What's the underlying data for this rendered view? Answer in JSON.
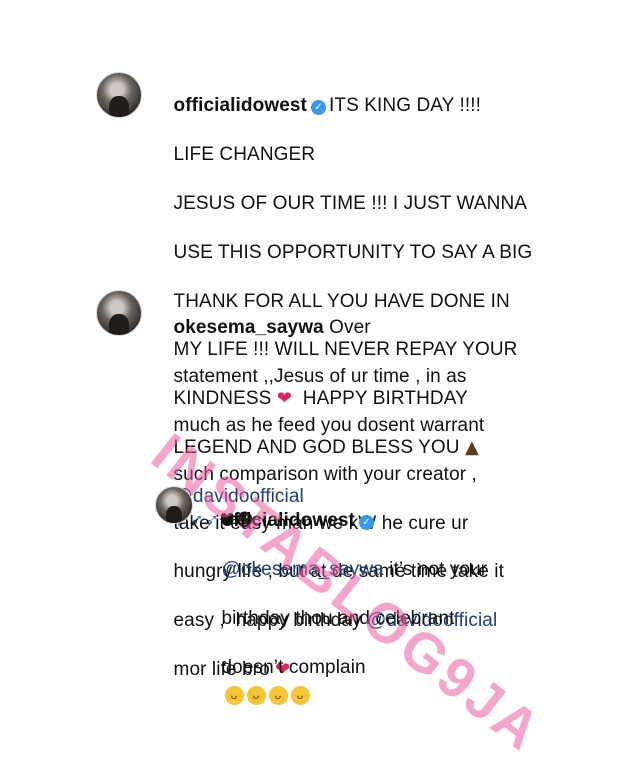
{
  "comments": [
    {
      "username": "officialidowest",
      "verified": true,
      "lines": [
        "ITS KING DAY !!!!",
        "LIFE CHANGER",
        "JESUS OF OUR TIME !!! I JUST WANNA",
        "USE THIS OPPORTUNITY TO SAY A BIG",
        "THANK FOR ALL YOU HAVE DONE IN",
        "MY LIFE !!! WILL NEVER REPAY YOUR",
        "KINDNESS",
        "HAPPY BIRTHDAY",
        "LEGEND AND GOD BLESS YOU",
        "@davidoofficial"
      ]
    },
    {
      "username": "okesema_saywa",
      "verified": false,
      "lines": [
        "Over",
        "statement ,,Jesus of ur time , in as",
        "much as he feed you dosent warrant",
        "such comparison with your creator ,",
        "take it easy man we kW he cure ur",
        "hungry life , but at de same time take it",
        "easy ,  happy birthday",
        "@davidoofficial",
        "mor life bro"
      ]
    },
    {
      "username": "officialidowest",
      "verified": true,
      "lines": [
        "@okesema_saywa",
        "it’s not your",
        "birthday thou and celebrant",
        "doesn’t complain"
      ]
    }
  ],
  "watermark": "INSTABLOG9JA",
  "icons": {
    "verified": "verified-badge-icon",
    "heart": "red-heart-icon",
    "rocket": "rocket-icon",
    "black_heart": "black-heart-icon",
    "praying_hands": "praying-hands-icon",
    "shrug": "person-shrugging-icon",
    "laugh": "face-with-tears-of-joy-icon"
  },
  "colors": {
    "mention": "#1b3f77",
    "verified": "#3897f0",
    "heart": "#e0245e",
    "watermark": "#ec5aa0"
  }
}
